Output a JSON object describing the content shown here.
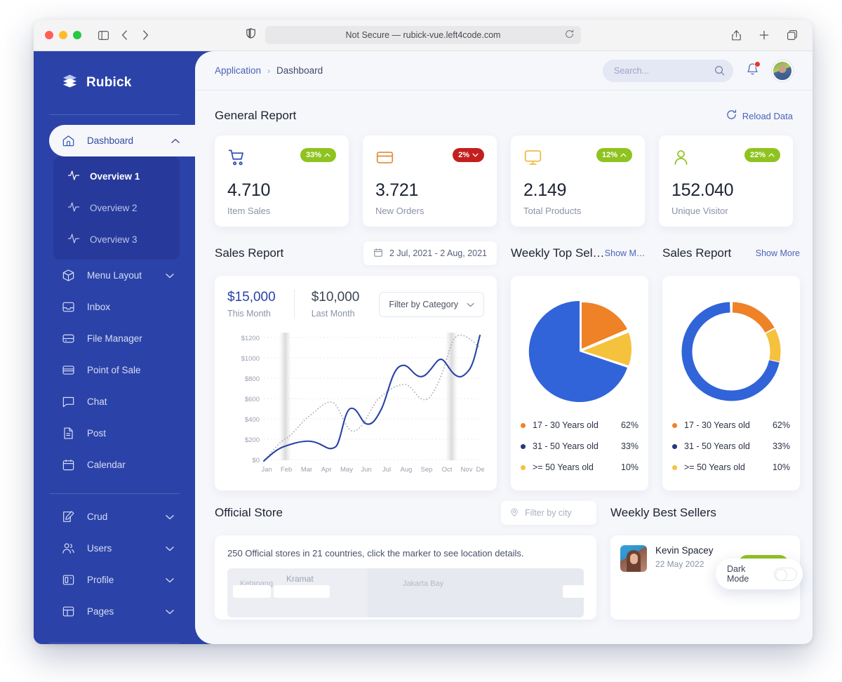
{
  "browser": {
    "url_text": "Not Secure — rubick-vue.left4code.com",
    "shield_icon": "shield-icon",
    "reload_icon": "reload-icon",
    "sidebar_toggle_icon": "sidebar-toggle-icon",
    "back_icon": "back-arrow-icon",
    "forward_icon": "forward-arrow-icon",
    "share_icon": "share-icon",
    "new_tab_icon": "plus-icon",
    "tabs_icon": "tabs-icon"
  },
  "sidebar": {
    "brand": "Rubick",
    "brand_icon": "layers-icon",
    "items": [
      {
        "label": "Dashboard",
        "icon": "home-icon",
        "active": true,
        "chevron": "chevron-up"
      },
      {
        "label": "Menu Layout",
        "icon": "cube-icon",
        "active": false,
        "chevron": "chevron-down"
      },
      {
        "label": "Inbox",
        "icon": "inbox-icon",
        "active": false,
        "chevron": ""
      },
      {
        "label": "File Manager",
        "icon": "drive-icon",
        "active": false,
        "chevron": ""
      },
      {
        "label": "Point of Sale",
        "icon": "card-icon",
        "active": false,
        "chevron": ""
      },
      {
        "label": "Chat",
        "icon": "chat-icon",
        "active": false,
        "chevron": ""
      },
      {
        "label": "Post",
        "icon": "file-icon",
        "active": false,
        "chevron": ""
      },
      {
        "label": "Calendar",
        "icon": "calendar-icon",
        "active": false,
        "chevron": ""
      }
    ],
    "submenu": [
      {
        "label": "Overview 1",
        "icon": "activity-icon",
        "current": true
      },
      {
        "label": "Overview 2",
        "icon": "activity-icon",
        "current": false
      },
      {
        "label": "Overview 3",
        "icon": "activity-icon",
        "current": false
      }
    ],
    "items_bottom": [
      {
        "label": "Crud",
        "icon": "edit-square-icon",
        "chevron": "chevron-down"
      },
      {
        "label": "Users",
        "icon": "users-icon",
        "chevron": "chevron-down"
      },
      {
        "label": "Profile",
        "icon": "profile-icon",
        "chevron": "chevron-down"
      },
      {
        "label": "Pages",
        "icon": "layout-icon",
        "chevron": "chevron-down"
      }
    ]
  },
  "topbar": {
    "breadcrumb_app": "Application",
    "breadcrumb_sep": "›",
    "breadcrumb_current": "Dashboard",
    "search_placeholder": "Search...",
    "search_value": "",
    "search_icon": "search-icon",
    "bell_icon": "bell-icon",
    "avatar": "user-avatar"
  },
  "general_report": {
    "title": "General Report",
    "reload_label": "Reload Data",
    "reload_icon": "refresh-icon",
    "cards": [
      {
        "icon": "shopping-cart-icon",
        "icon_color": "#2a4ab3",
        "badge": "33%",
        "dir": "up",
        "value": "4.710",
        "label": "Item Sales"
      },
      {
        "icon": "credit-card-icon",
        "icon_color": "#e08b36",
        "badge": "2%",
        "dir": "down",
        "value": "3.721",
        "label": "New Orders"
      },
      {
        "icon": "monitor-icon",
        "icon_color": "#f1b63a",
        "badge": "12%",
        "dir": "up",
        "value": "2.149",
        "label": "Total Products"
      },
      {
        "icon": "user-icon",
        "icon_color": "#8fc31f",
        "badge": "22%",
        "dir": "up",
        "value": "152.040",
        "label": "Unique Visitor"
      }
    ]
  },
  "sales_report": {
    "title": "Sales Report",
    "date_range": "2 Jul, 2021 - 2 Aug, 2021",
    "date_icon": "calendar-icon",
    "this_month_amount": "$15,000",
    "this_month_label": "This Month",
    "last_month_amount": "$10,000",
    "last_month_label": "Last Month",
    "filter_label": "Filter by Category",
    "filter_chevron": "chevron-down-icon"
  },
  "weekly_top_sellers": {
    "title": "Weekly Top Sell...",
    "show_more": "Show Mo..."
  },
  "sales_report_donut": {
    "title": "Sales Report",
    "show_more": "Show More"
  },
  "age_legend": [
    {
      "label": "17 - 30 Years old",
      "value": "62%",
      "color": "#ef8127"
    },
    {
      "label": "31 - 50 Years old",
      "value": "33%",
      "color": "#26387f"
    },
    {
      "label": ">= 50 Years old",
      "value": "10%",
      "color": "#f5c23e"
    }
  ],
  "official_store": {
    "title": "Official Store",
    "filter_placeholder": "Filter by city",
    "filter_icon": "map-pin-icon",
    "note": "250 Official stores in 21 countries, click the marker to see location details.",
    "map_labels": [
      "Ketapang",
      "Kramat",
      "Jakarta Bay"
    ]
  },
  "weekly_best_sellers": {
    "title": "Weekly Best Sellers",
    "seller_name": "Kevin Spacey",
    "seller_date": "22 May 2022"
  },
  "dark_mode": {
    "label": "Dark Mode",
    "enabled": false
  },
  "colors": {
    "sidebar": "#2b43a8",
    "submenu": "#27399a",
    "content_bg": "#f6f7fb",
    "accent_blue": "#2a4ab3",
    "green": "#8fc31f",
    "red": "#c41f1f",
    "orange": "#ef8127",
    "yellow": "#f5c23e"
  },
  "chart_data": [
    {
      "type": "line",
      "title": "Sales Report",
      "xlabel": "",
      "ylabel": "",
      "categories": [
        "Jan",
        "Feb",
        "Mar",
        "Apr",
        "May",
        "Jun",
        "Jul",
        "Aug",
        "Sep",
        "Oct",
        "Nov",
        "Dec"
      ],
      "ytick_labels": [
        "$0",
        "$200",
        "$400",
        "$600",
        "$800",
        "$1000",
        "$1200"
      ],
      "ylim": [
        0,
        1200
      ],
      "grid": true,
      "legend": "none",
      "series": [
        {
          "name": "This Month",
          "style": "solid",
          "color": "#2843a7",
          "values": [
            80,
            230,
            250,
            190,
            510,
            440,
            860,
            1050,
            950,
            1100,
            900,
            1230
          ]
        },
        {
          "name": "Last Month",
          "style": "dotted",
          "color": "#9aa0b0",
          "values": [
            60,
            300,
            430,
            560,
            320,
            620,
            790,
            850,
            690,
            940,
            1200,
            1060
          ]
        }
      ],
      "highlight_bands": [
        "Feb",
        "Nov"
      ]
    },
    {
      "type": "pie",
      "title": "Weekly Top Sell...",
      "labels": [
        "17 - 30 Years old",
        "31 - 50 Years old",
        ">= 50 Years old"
      ],
      "legend_values": [
        62,
        33,
        10
      ],
      "slice_fractions": [
        0.18,
        0.7,
        0.12
      ],
      "colors": [
        "#ef8127",
        "#3064d8",
        "#f5c23e"
      ],
      "legend": "bottom"
    },
    {
      "type": "pie",
      "title": "Sales Report",
      "variant": "donut",
      "labels": [
        "17 - 30 Years old",
        "31 - 50 Years old",
        ">= 50 Years old"
      ],
      "legend_values": [
        62,
        33,
        10
      ],
      "slice_fractions": [
        0.17,
        0.71,
        0.12
      ],
      "colors": [
        "#ef8127",
        "#3064d8",
        "#f5c23e"
      ],
      "legend": "bottom"
    }
  ]
}
